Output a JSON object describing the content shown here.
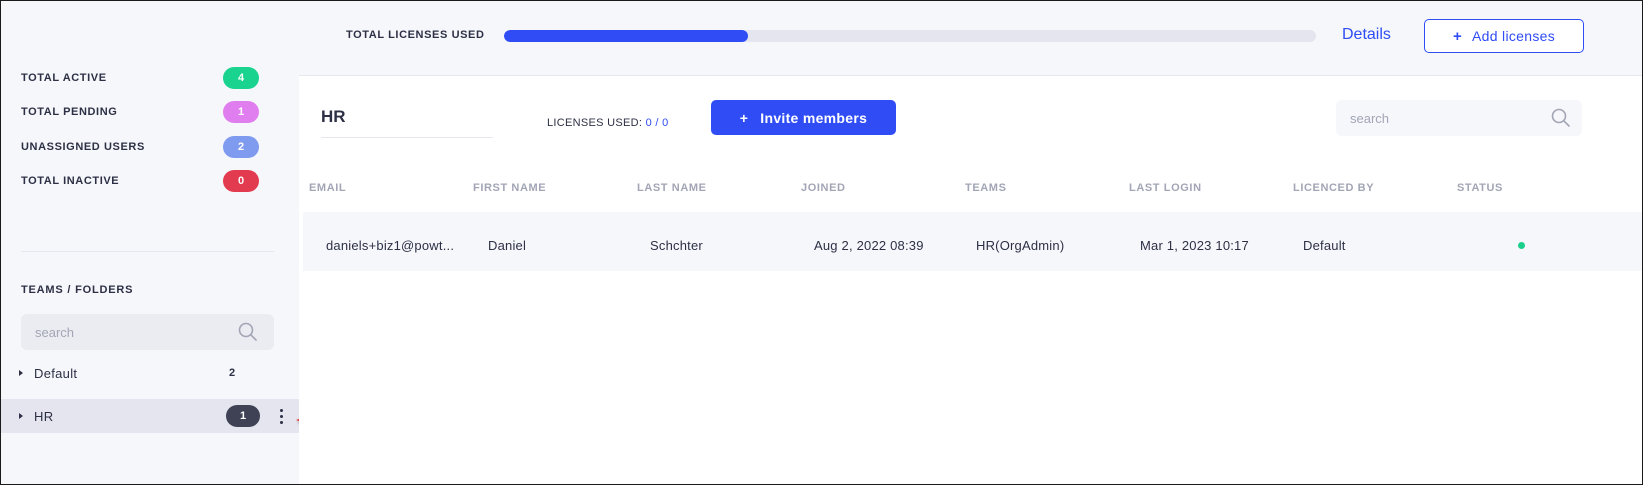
{
  "sidebar": {
    "stats": [
      {
        "label": "TOTAL ACTIVE",
        "count": "4",
        "color": "#19d38f"
      },
      {
        "label": "TOTAL PENDING",
        "count": "1",
        "color": "#e07ef0"
      },
      {
        "label": "UNASSIGNED USERS",
        "count": "2",
        "color": "#7e9bf0"
      },
      {
        "label": "TOTAL INACTIVE",
        "count": "0",
        "color": "#e23a4f"
      }
    ],
    "teams_title": "TEAMS / FOLDERS",
    "search_placeholder": "search",
    "teams": [
      {
        "name": "Default",
        "count": "2",
        "selected": false
      },
      {
        "name": "HR",
        "count": "1",
        "selected": true
      }
    ]
  },
  "topbar": {
    "licenses_label": "TOTAL LICENSES USED",
    "progress_fraction": 0.3,
    "details_label": "Details",
    "add_licenses_label": "Add licenses"
  },
  "main": {
    "folder_name": "HR",
    "licenses_used_label": "LICENSES USED:",
    "licenses_used_value": "0 / 0",
    "invite_label": "Invite members",
    "search_placeholder": "search"
  },
  "table": {
    "headers": [
      "EMAIL",
      "FIRST NAME",
      "LAST NAME",
      "JOINED",
      "TEAMS",
      "LAST LOGIN",
      "LICENCED BY",
      "STATUS"
    ],
    "rows": [
      {
        "email": "daniels+biz1@powt...",
        "first_name": "Daniel",
        "last_name": "Schchter",
        "joined": "Aug 2, 2022 08:39",
        "teams": "HR(OrgAdmin)",
        "last_login": "Mar 1, 2023 10:17",
        "licenced_by": "Default",
        "status": "active"
      }
    ]
  },
  "colors": {
    "accent": "#2f4cf5",
    "status_active": "#19cf8b",
    "annotation_arrow": "#e8413f"
  }
}
